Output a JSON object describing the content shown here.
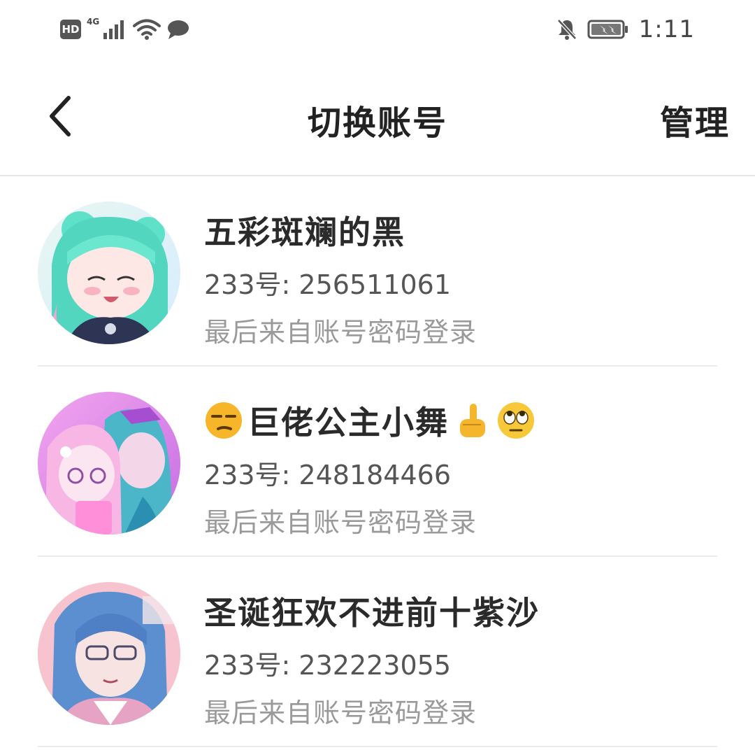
{
  "status_bar": {
    "hd_badge": "HD",
    "network_type": "4G",
    "time": "1:11",
    "icons": [
      "hd-icon",
      "signal-icon",
      "wifi-icon",
      "message-icon",
      "bell-muted-icon",
      "battery-charging-icon"
    ]
  },
  "header": {
    "title": "切换账号",
    "manage_label": "管理",
    "back_icon": "chevron-left-icon"
  },
  "accounts": [
    {
      "name": "五彩斑斓的黑",
      "name_prefix_emoji": "",
      "name_suffix_emoji": "",
      "uid_text": "233号: 256511061",
      "login_method": "最后来自账号密码登录",
      "avatar_colors": [
        "#5fe0c8",
        "#3a3f5c",
        "#f7c9d8"
      ]
    },
    {
      "name": "巨佬公主小舞",
      "name_prefix_emoji": "unamused-face-emoji",
      "name_suffix_emoji": "pointing-up-emoji, rolling-eyes-emoji",
      "uid_text": "233号: 248184466",
      "login_method": "最后来自账号密码登录",
      "avatar_colors": [
        "#f6a6e6",
        "#4bb6c8",
        "#e57ad6"
      ]
    },
    {
      "name": "圣诞狂欢不进前十紫沙",
      "name_prefix_emoji": "",
      "name_suffix_emoji": "",
      "uid_text": "233号: 232223055",
      "login_method": "最后来自账号密码登录",
      "avatar_colors": [
        "#f3a7b9",
        "#4f86c2",
        "#8a5a8e"
      ]
    }
  ]
}
